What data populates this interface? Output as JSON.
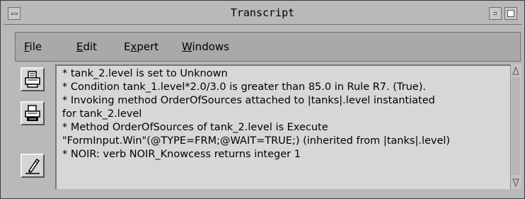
{
  "window": {
    "title": "Transcript"
  },
  "menubar": {
    "items": [
      {
        "pre": "",
        "u": "F",
        "post": "ile"
      },
      {
        "pre": "",
        "u": "E",
        "post": "dit"
      },
      {
        "pre": "E",
        "u": "x",
        "post": "pert"
      },
      {
        "pre": "",
        "u": "W",
        "post": "indows"
      }
    ]
  },
  "toolbar": {
    "buttons": [
      {
        "icon": "print-icon"
      },
      {
        "icon": "print-setup-icon"
      },
      {
        "icon": "edit-pencil-icon"
      }
    ]
  },
  "transcript": {
    "lines": [
      "* tank_2.level is set to Unknown",
      "* Condition tank_1.level*2.0/3.0 is greater than 85.0 in Rule R7. (True).",
      "* Invoking method OrderOfSources attached to |tanks|.level instantiated",
      "for tank_2.level",
      "* Method OrderOfSources of tank_2.level is Execute",
      "\"FormInput.Win\"(@TYPE=FRM;@WAIT=TRUE;) (inherited from |tanks|.level)",
      "* NOIR: verb NOIR_Knowcess returns integer 1"
    ]
  }
}
